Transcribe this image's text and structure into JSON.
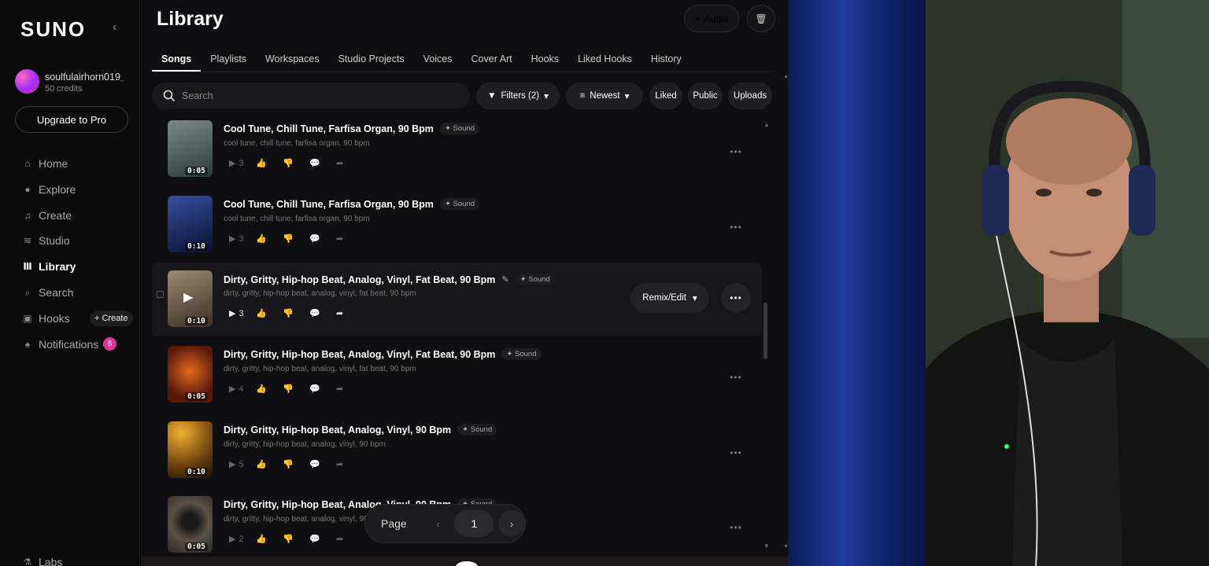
{
  "app": {
    "logo": "SUNO"
  },
  "user": {
    "name": "soulfulairhorn019",
    "credits": "50 credits"
  },
  "sidebar": {
    "upgrade_label": "Upgrade to Pro",
    "nav": [
      {
        "label": "Home",
        "icon": "home-icon"
      },
      {
        "label": "Explore",
        "icon": "compass-icon"
      },
      {
        "label": "Create",
        "icon": "music-note-icon"
      },
      {
        "label": "Studio",
        "icon": "studio-icon"
      },
      {
        "label": "Library",
        "icon": "library-icon",
        "active": true
      },
      {
        "label": "Search",
        "icon": "search-icon"
      },
      {
        "label": "Hooks",
        "icon": "hooks-icon"
      },
      {
        "label": "Notifications",
        "icon": "bell-icon"
      },
      {
        "label": "Labs",
        "icon": "flask-icon"
      }
    ],
    "hooks_create_label": "+ Create",
    "notification_count": "6"
  },
  "page": {
    "title": "Library"
  },
  "header": {
    "audio_label": "Audio"
  },
  "tabs": [
    "Songs",
    "Playlists",
    "Workspaces",
    "Studio Projects",
    "Voices",
    "Cover Art",
    "Hooks",
    "Liked Hooks",
    "History"
  ],
  "toolbar": {
    "search_placeholder": "Search",
    "filters_label": "Filters (2)",
    "sort_label": "Newest",
    "liked_label": "Liked",
    "public_label": "Public",
    "uploads_label": "Uploads"
  },
  "songs": [
    {
      "title": "Cool Tune, Chill Tune, Farfisa Organ, 90 Bpm",
      "tag": "Sound",
      "desc": "cool tune, chill tune, farfisa organ, 90 bpm",
      "duration": "0:05",
      "plays": "3",
      "art": "#4a5a5a"
    },
    {
      "title": "Cool Tune, Chill Tune, Farfisa Organ, 90 Bpm",
      "tag": "Sound",
      "desc": "cool tune, chill tune, farfisa organ, 90 bpm",
      "duration": "0:10",
      "plays": "3",
      "art": "#1c2a55"
    },
    {
      "title": "Dirty, Gritty, Hip-hop Beat, Analog, Vinyl, Fat Beat, 90 Bpm",
      "tag": "Sound",
      "desc": "dirty, gritty, hip-hop beat, analog, vinyl, fat beat, 90 bpm",
      "duration": "0:10",
      "plays": "3",
      "art": "#5a4f40"
    },
    {
      "title": "Dirty, Gritty, Hip-hop Beat, Analog, Vinyl, Fat Beat, 90 Bpm",
      "tag": "Sound",
      "desc": "dirty, gritty, hip-hop beat, analog, vinyl, fat beat, 90 bpm",
      "duration": "0:05",
      "plays": "4",
      "art": "#8a2a10"
    },
    {
      "title": "Dirty, Gritty, Hip-hop Beat, Analog, Vinyl, 90 Bpm",
      "tag": "Sound",
      "desc": "dirty, gritty, hip-hop beat, analog, vinyl, 90 bpm",
      "duration": "0:10",
      "plays": "5",
      "art": "#6a4a10"
    },
    {
      "title": "Dirty, Gritty, Hip-hop Beat, Analog, Vinyl, 90 Bpm",
      "tag": "Sound",
      "desc": "dirty, gritty, hip-hop beat, analog, vinyl, 90 bpm",
      "duration": "0:05",
      "plays": "2",
      "art": "#3a3530"
    }
  ],
  "row_actions": {
    "remix_label": "Remix/Edit"
  },
  "pager": {
    "label": "Page",
    "current": "1"
  }
}
